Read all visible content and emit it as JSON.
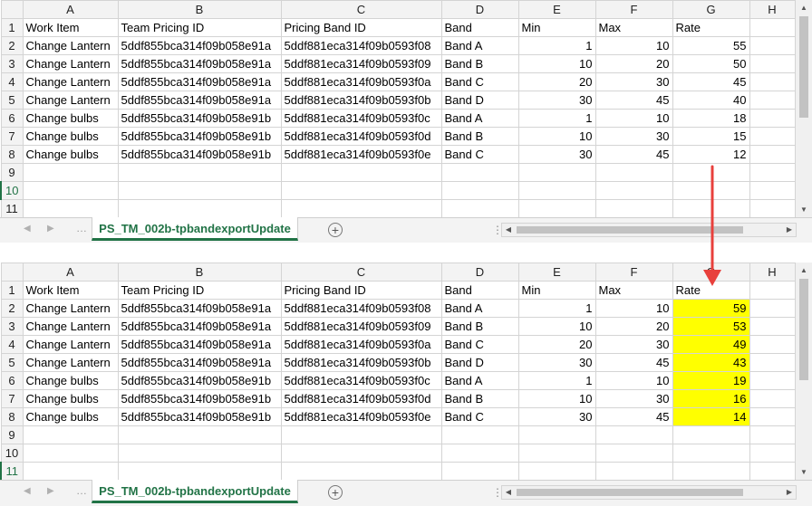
{
  "columns": [
    "A",
    "B",
    "C",
    "D",
    "E",
    "F",
    "G",
    "H"
  ],
  "header_row": [
    "Work Item",
    "Team Pricing ID",
    "Pricing Band ID",
    "Band",
    "Min",
    "Max",
    "Rate",
    ""
  ],
  "sheet_tab": "PS_TM_002b-tpbandexportUpdate",
  "top": {
    "rows": [
      [
        "Change Lantern",
        "5ddf855bca314f09b058e91a",
        "5ddf881eca314f09b0593f08",
        "Band A",
        "1",
        "10",
        "55"
      ],
      [
        "Change Lantern",
        "5ddf855bca314f09b058e91a",
        "5ddf881eca314f09b0593f09",
        "Band B",
        "10",
        "20",
        "50"
      ],
      [
        "Change Lantern",
        "5ddf855bca314f09b058e91a",
        "5ddf881eca314f09b0593f0a",
        "Band C",
        "20",
        "30",
        "45"
      ],
      [
        "Change Lantern",
        "5ddf855bca314f09b058e91a",
        "5ddf881eca314f09b0593f0b",
        "Band D",
        "30",
        "45",
        "40"
      ],
      [
        "Change bulbs",
        "5ddf855bca314f09b058e91b",
        "5ddf881eca314f09b0593f0c",
        "Band A",
        "1",
        "10",
        "18"
      ],
      [
        "Change bulbs",
        "5ddf855bca314f09b058e91b",
        "5ddf881eca314f09b0593f0d",
        "Band B",
        "10",
        "30",
        "15"
      ],
      [
        "Change bulbs",
        "5ddf855bca314f09b058e91b",
        "5ddf881eca314f09b0593f0e",
        "Band C",
        "30",
        "45",
        "12"
      ]
    ],
    "row_numbers": [
      "1",
      "2",
      "3",
      "4",
      "5",
      "6",
      "7",
      "8",
      "9",
      "10",
      "11"
    ],
    "active_row": "10"
  },
  "bottom": {
    "rows": [
      [
        "Change Lantern",
        "5ddf855bca314f09b058e91a",
        "5ddf881eca314f09b0593f08",
        "Band A",
        "1",
        "10",
        "59"
      ],
      [
        "Change Lantern",
        "5ddf855bca314f09b058e91a",
        "5ddf881eca314f09b0593f09",
        "Band B",
        "10",
        "20",
        "53"
      ],
      [
        "Change Lantern",
        "5ddf855bca314f09b058e91a",
        "5ddf881eca314f09b0593f0a",
        "Band C",
        "20",
        "30",
        "49"
      ],
      [
        "Change Lantern",
        "5ddf855bca314f09b058e91a",
        "5ddf881eca314f09b0593f0b",
        "Band D",
        "30",
        "45",
        "43"
      ],
      [
        "Change bulbs",
        "5ddf855bca314f09b058e91b",
        "5ddf881eca314f09b0593f0c",
        "Band A",
        "1",
        "10",
        "19"
      ],
      [
        "Change bulbs",
        "5ddf855bca314f09b058e91b",
        "5ddf881eca314f09b0593f0d",
        "Band B",
        "10",
        "30",
        "16"
      ],
      [
        "Change bulbs",
        "5ddf855bca314f09b058e91b",
        "5ddf881eca314f09b0593f0e",
        "Band C",
        "30",
        "45",
        "14"
      ]
    ],
    "row_numbers": [
      "1",
      "2",
      "3",
      "4",
      "5",
      "6",
      "7",
      "8",
      "9",
      "10",
      "11"
    ],
    "active_row": "11"
  },
  "icons": {
    "add_sheet": "+",
    "arrow_up": "▲",
    "arrow_down": "▼",
    "arrow_left": "◀",
    "arrow_right": "▶",
    "tab_prev": "◀",
    "tab_next": "▶",
    "tab_dots": "…",
    "split": "⋮"
  },
  "colors": {
    "highlight": "#ffff00",
    "accent": "#217346",
    "annotation_arrow": "#e8403c"
  }
}
